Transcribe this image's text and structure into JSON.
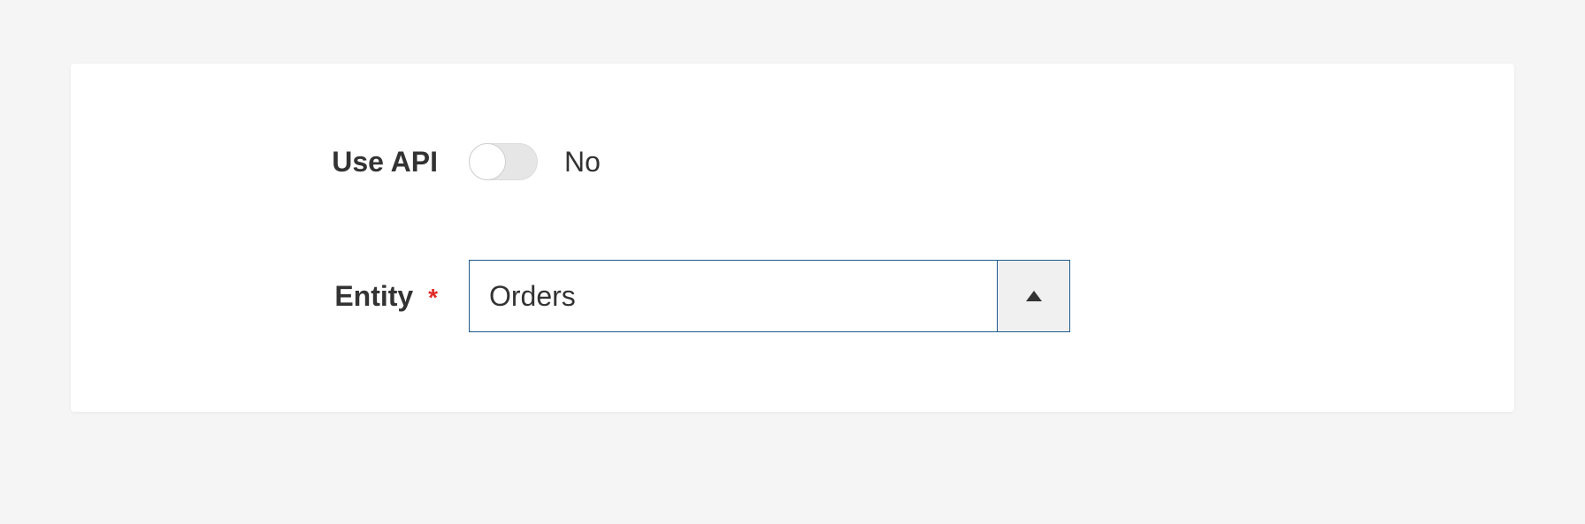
{
  "form": {
    "use_api": {
      "label": "Use API",
      "state_text": "No"
    },
    "entity": {
      "label": "Entity",
      "required_mark": "*",
      "selected": "Orders"
    }
  }
}
